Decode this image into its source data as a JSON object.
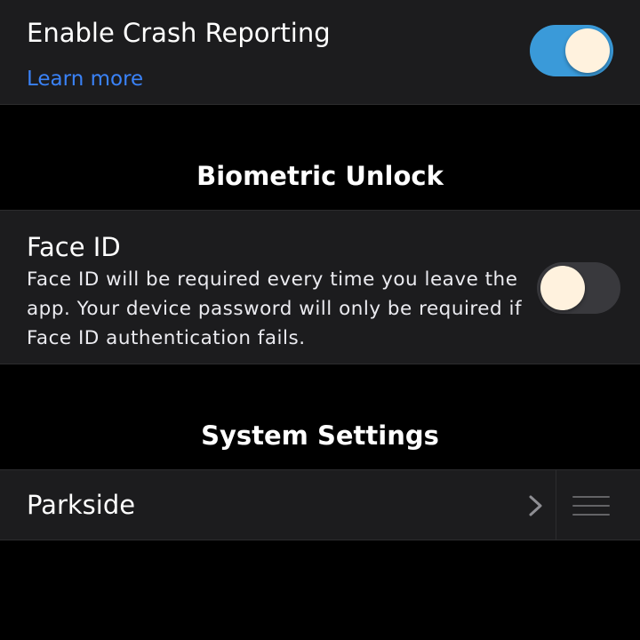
{
  "crash_reporting": {
    "title": "Enable Crash Reporting",
    "learn_more": "Learn more",
    "toggle_state": "on"
  },
  "biometric_unlock": {
    "header": "Biometric Unlock",
    "face_id": {
      "title": "Face ID",
      "description": "Face ID will be required every time you leave the app. Your device password will only be required if Face ID authentication fails.",
      "toggle_state": "off"
    }
  },
  "system_settings": {
    "header": "System Settings",
    "items": [
      {
        "label": "Parkside"
      }
    ]
  },
  "icons": {
    "chevron": "chevron-right-icon",
    "reorder": "reorder-handle-icon"
  },
  "colors": {
    "background": "#000000",
    "cell_background": "#1c1c1e",
    "link": "#3a82f7",
    "toggle_on": "#3a9ad9",
    "toggle_off": "#39393d",
    "toggle_knob": "#fff2de"
  }
}
